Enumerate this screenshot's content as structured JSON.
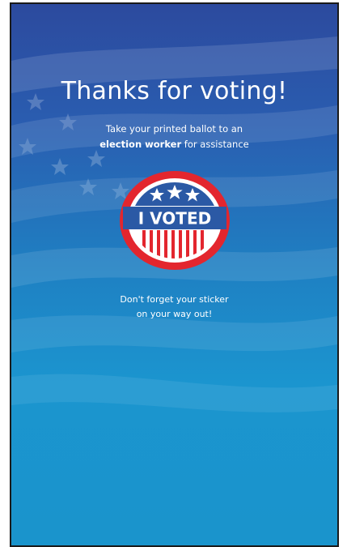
{
  "screen": {
    "headline": "Thanks for voting!",
    "instruction_line1": "Take your printed ballot to an",
    "instruction_bold": "election worker",
    "instruction_rest": " for assistance",
    "reminder_line1": "Don't forget your sticker",
    "reminder_line2": "on your way out!"
  },
  "sticker": {
    "label": "I VOTED",
    "icon": "i-voted-sticker-icon",
    "star_count": 3
  },
  "colors": {
    "background_top": "#2c4a9e",
    "background_bottom": "#1a94cc",
    "sticker_red": "#e3262e",
    "sticker_blue": "#2b59a5",
    "text": "#ffffff"
  }
}
